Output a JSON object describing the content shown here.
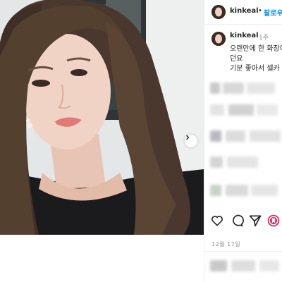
{
  "post": {
    "photo_alt": "selfie",
    "next_arrow": "chevron-right-icon"
  },
  "header": {
    "username": "kinkeal",
    "separator": "•",
    "follow_label": "팔로우"
  },
  "caption": {
    "username": "kinkeal",
    "time": "1주",
    "lines": [
      "오랜만에 한 화장이",
      "던요",
      "기분 좋아서 셀카"
    ]
  },
  "actions": {
    "icons": [
      "heart-icon",
      "comment-icon",
      "share-icon",
      "bookmark-icon"
    ]
  },
  "date_label": "12월 17일",
  "colors": {
    "accent": "#0095f6",
    "text": "#262626",
    "muted": "#8e8e8e"
  }
}
